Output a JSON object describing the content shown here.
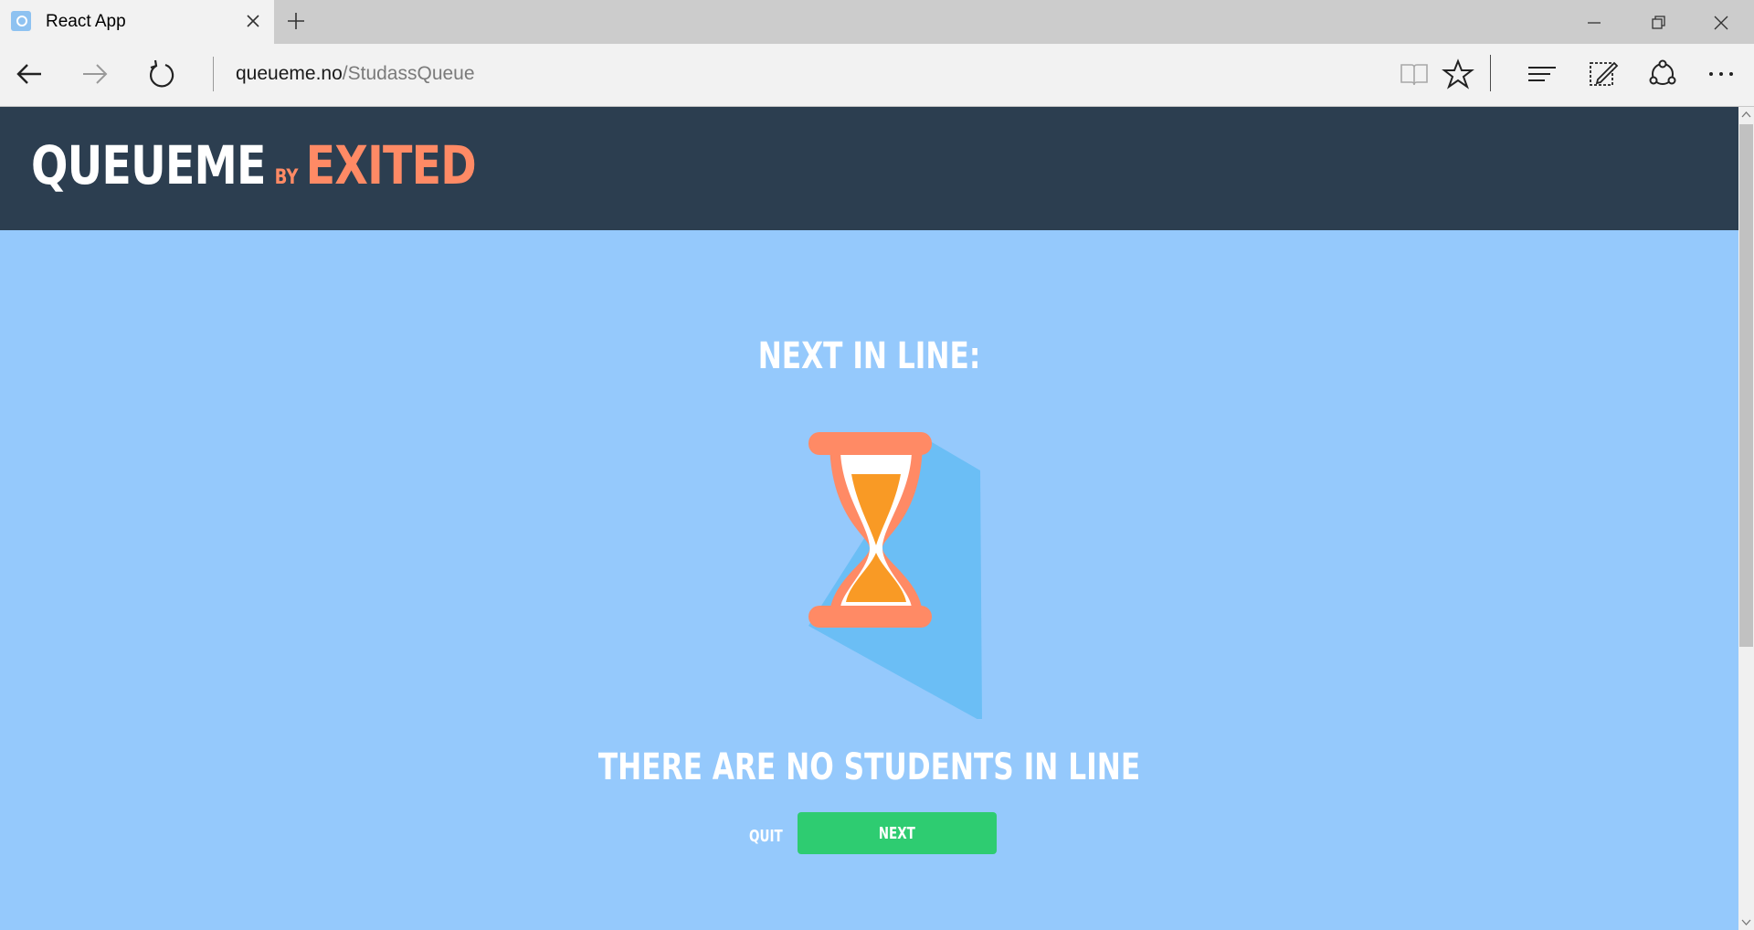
{
  "browser": {
    "tab_title": "React App",
    "address_host": "queueme.no",
    "address_path": "/StudassQueue"
  },
  "header": {
    "brand_main": "QUEUEME",
    "brand_by": "BY",
    "brand_accent": "EXITED"
  },
  "main": {
    "next_title": "NEXT IN LINE:",
    "empty_message": "THERE ARE NO STUDENTS IN LINE",
    "quit_label": "QUIT",
    "next_label": "NEXT"
  },
  "colors": {
    "header_bg": "#2c3e50",
    "page_bg": "#95c9fc",
    "accent": "#ff8a65",
    "button_green": "#2ecc71",
    "sand": "#f99a25",
    "shadow": "#6bbef5"
  },
  "icons": [
    "reading-view-icon",
    "favorite-star-icon",
    "hub-icon",
    "web-note-icon",
    "share-icon",
    "more-icon",
    "hourglass-icon"
  ]
}
